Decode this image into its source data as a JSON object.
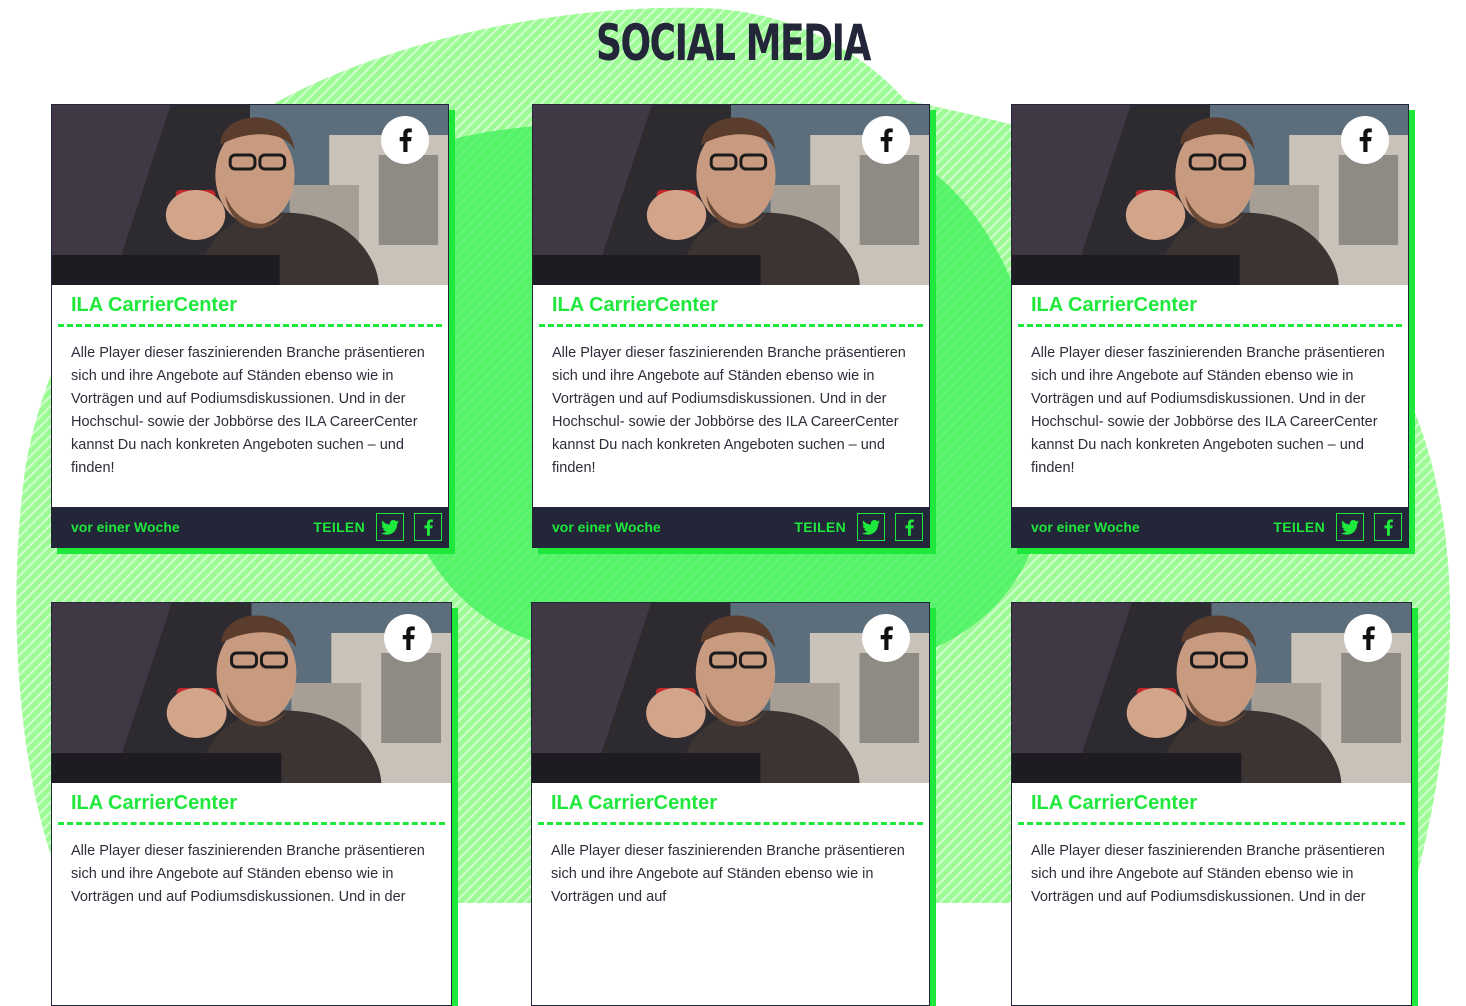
{
  "section": {
    "title": "Social Media"
  },
  "colors": {
    "accent": "#1ee83b",
    "navy": "#232638",
    "blob": "#9cfb94"
  },
  "posts": [
    {
      "network_icon": "facebook-icon",
      "title": "ILA CarrierCenter",
      "text": "Alle Player dieser faszinierenden Branche präsentieren sich und ihre Angebote auf Ständen ebenso wie in Vorträgen und auf Podiumsdiskussionen. Und in der Hochschul- sowie der Jobbörse des ILA CareerCenter kannst Du nach konkreten Angeboten suchen – und finden!",
      "date": "vor einer Woche",
      "share_label": "TEILEN",
      "share_icons": [
        "twitter-icon",
        "facebook-icon"
      ]
    },
    {
      "network_icon": "facebook-icon",
      "title": "ILA CarrierCenter",
      "text": "Alle Player dieser faszinierenden Branche präsentieren sich und ihre Angebote auf Ständen ebenso wie in Vorträgen und auf Podiumsdiskussionen. Und in der Hochschul- sowie der Jobbörse des ILA CareerCenter kannst Du nach konkreten Angeboten suchen – und finden!",
      "date": "vor einer Woche",
      "share_label": "TEILEN",
      "share_icons": [
        "twitter-icon",
        "facebook-icon"
      ]
    },
    {
      "network_icon": "facebook-icon",
      "title": "ILA CarrierCenter",
      "text": "Alle Player dieser faszinierenden Branche präsentieren sich und ihre Angebote auf Ständen ebenso wie in Vorträgen und auf Podiumsdiskussionen. Und in der Hochschul- sowie der Jobbörse des ILA CareerCenter kannst Du nach konkreten Angeboten suchen – und finden!",
      "date": "vor einer Woche",
      "share_label": "TEILEN",
      "share_icons": [
        "twitter-icon",
        "facebook-icon"
      ]
    },
    {
      "network_icon": "facebook-icon",
      "title": "ILA CarrierCenter",
      "text": "Alle Player dieser faszinierenden Branche präsentieren sich und ihre Angebote auf Ständen ebenso wie in Vorträgen und auf Podiumsdiskussionen. Und in der"
    },
    {
      "network_icon": "facebook-icon",
      "title": "ILA CarrierCenter",
      "text": "Alle Player dieser faszinierenden Branche präsentieren sich und ihre Angebote auf Ständen ebenso wie in Vorträgen und auf"
    },
    {
      "network_icon": "facebook-icon",
      "title": "ILA CarrierCenter",
      "text": "Alle Player dieser faszinierenden Branche präsentieren sich und ihre Angebote auf Ständen ebenso wie in Vorträgen und auf Podiumsdiskussionen. Und in der"
    }
  ]
}
